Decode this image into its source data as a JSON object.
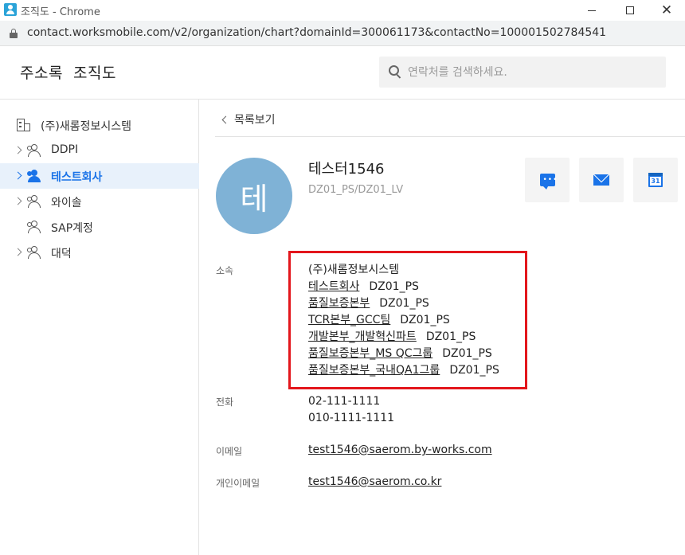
{
  "window": {
    "title": "조직도 - Chrome",
    "close_glyph": "✕"
  },
  "browser": {
    "url": "contact.worksmobile.com/v2/organization/chart?domainId=300061173&contactNo=100001502784541"
  },
  "header": {
    "title": "주소록  조직도",
    "search_placeholder": "연락처를 검색하세요."
  },
  "sidebar": {
    "root": "(주)새롬정보시스템",
    "items": [
      {
        "label": "DDPI",
        "expandable": true,
        "active": false
      },
      {
        "label": "테스트회사",
        "expandable": true,
        "active": true
      },
      {
        "label": "와이솔",
        "expandable": true,
        "active": false
      },
      {
        "label": "SAP계정",
        "expandable": false,
        "active": false
      },
      {
        "label": "대덕",
        "expandable": true,
        "active": false
      }
    ]
  },
  "main": {
    "back_label": "목록보기",
    "person": {
      "avatar_initial": "테",
      "name": "테스터1546",
      "position": "DZ01_PS/DZ01_LV"
    },
    "labels": {
      "department": "소속",
      "phone": "전화",
      "email": "이메일",
      "personal_email": "개인이메일"
    },
    "departments": [
      {
        "name": "(주)새롬정보시스템",
        "code": "",
        "link": false
      },
      {
        "name": "테스트회사",
        "code": "DZ01_PS",
        "link": true
      },
      {
        "name": "품질보증본부",
        "code": "DZ01_PS",
        "link": true
      },
      {
        "name": "TCR본부_GCC팀",
        "code": "DZ01_PS",
        "link": true
      },
      {
        "name": "개발본부_개발혁신파트",
        "code": "DZ01_PS",
        "link": true
      },
      {
        "name": "품질보증본부_MS QC그룹",
        "code": "DZ01_PS",
        "link": true
      },
      {
        "name": "품질보증본부_국내QA1그룹",
        "code": "DZ01_PS",
        "link": true
      }
    ],
    "phones": [
      "02-111-1111",
      "010-1111-1111"
    ],
    "email": "test1546@saerom.by-works.com",
    "personal_email": "test1546@saerom.co.kr",
    "calendar_day": "31"
  },
  "colors": {
    "accent": "#1a73e8",
    "highlight_border": "#e3161c",
    "avatar_bg": "#7fb2d6",
    "active_row_bg": "#e8f1fb"
  }
}
